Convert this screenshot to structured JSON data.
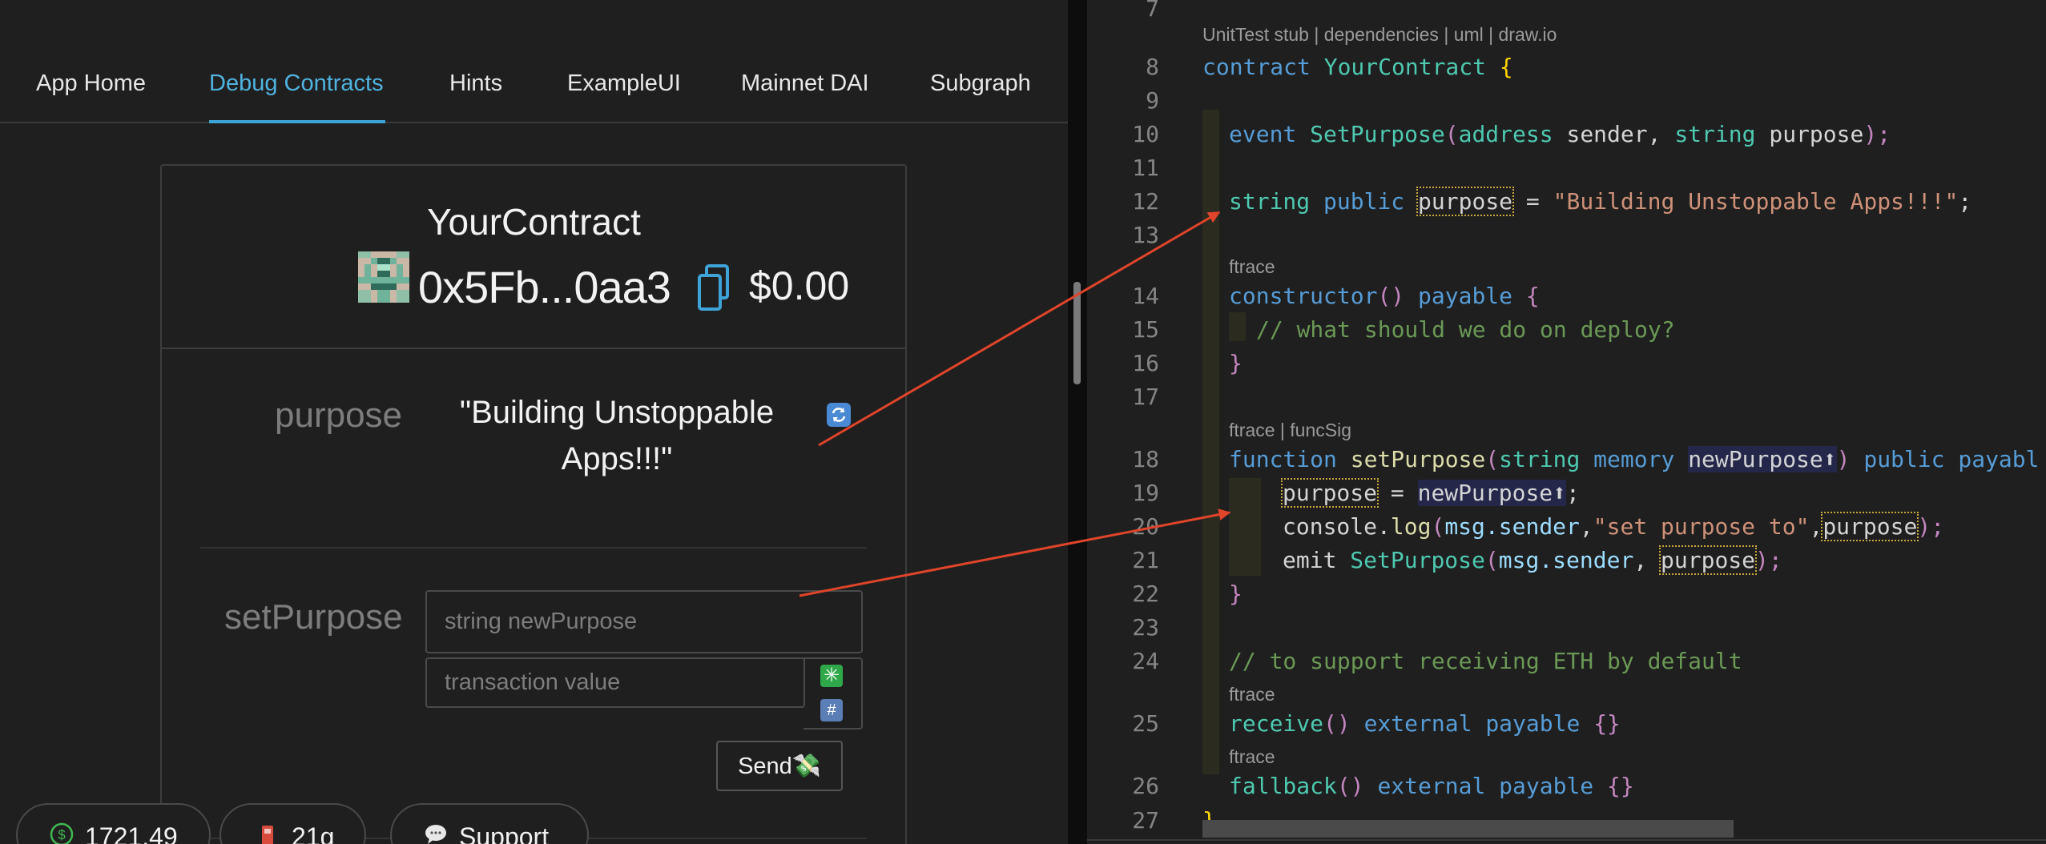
{
  "nav": {
    "items": [
      "App Home",
      "Debug Contracts",
      "Hints",
      "ExampleUI",
      "Mainnet DAI",
      "Subgraph"
    ],
    "active": "Debug Contracts"
  },
  "contract": {
    "name": "YourContract",
    "address": "0x5Fb...0aa3",
    "balance": "$0.00"
  },
  "purpose": {
    "label": "purpose",
    "value": "\"Building Unstoppable Apps!!!\""
  },
  "setPurpose": {
    "label": "setPurpose",
    "input_placeholder": "string newPurpose",
    "value_placeholder": "transaction value",
    "send_label": "Send💸"
  },
  "footer": {
    "balance": "1721.49",
    "gas": "21g",
    "support": "Support"
  },
  "editor": {
    "lens_top": "UnitTest stub | dependencies | uml | draw.io",
    "line_numbers": [
      "7",
      "8",
      "9",
      "10",
      "11",
      "12",
      "13",
      "14",
      "15",
      "16",
      "17",
      "18",
      "19",
      "20",
      "21",
      "22",
      "23",
      "24",
      "25",
      "26",
      "27"
    ],
    "lens_ftrace": "ftrace",
    "lens_ftrace_funcsig": "ftrace | funcSig",
    "lines": {
      "l8": [
        "contract",
        "YourContract",
        "{"
      ],
      "l10": [
        "event",
        "SetPurpose",
        "(",
        "address",
        "sender, ",
        "string",
        "purpose",
        ");"
      ],
      "l12": [
        "string",
        "public",
        "purpose",
        " = ",
        "\"Building Unstoppable Apps!!!\"",
        ";"
      ],
      "l14": [
        "constructor",
        "()",
        "payable",
        "{"
      ],
      "l15": "// what should we do on deploy?",
      "l16": "}",
      "l18": [
        "function",
        "setPurpose",
        "(",
        "string",
        "memory",
        "newPurpose⬆",
        ")",
        "public",
        "payabl"
      ],
      "l19": [
        "purpose",
        " = ",
        "newPurpose⬆",
        ";"
      ],
      "l20": [
        "console",
        ".",
        "log",
        "(",
        "msg.sender",
        ",",
        "\"set purpose to\"",
        ",",
        "purpose",
        ");"
      ],
      "l21": [
        "emit",
        "SetPurpose",
        "(",
        "msg.sender",
        ", ",
        "purpose",
        ");"
      ],
      "l22": "}",
      "l24": "// to support receiving ETH by default",
      "l25": [
        "receive",
        "()",
        "external",
        "payable",
        "{}"
      ],
      "l26": [
        "fallback",
        "()",
        "external",
        "payable",
        "{}"
      ],
      "l27": "}"
    }
  },
  "colors": {
    "accent": "#4fb3e0",
    "arrow": "#e0442a",
    "background": "#1f1f1f"
  }
}
